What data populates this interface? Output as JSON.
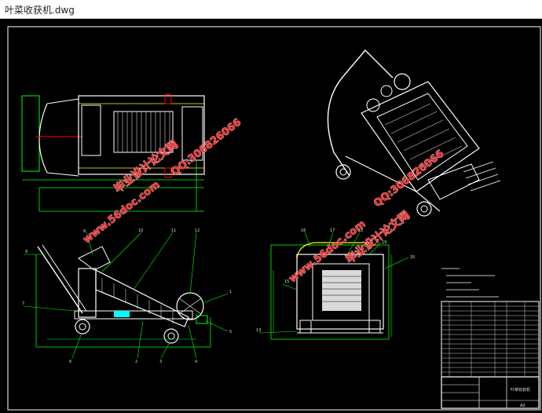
{
  "window": {
    "title": "叶菜收获机.dwg"
  },
  "colors": {
    "canvas": "#000000",
    "frame_white": "#ffffff",
    "cad_green": "#00ff00",
    "cad_yellow": "#ffff00",
    "cad_red": "#ff0000",
    "cad_cyan": "#00ffff",
    "watermark": "#ff2a2a"
  },
  "drawing": {
    "watermarks": [
      "毕业设计论文网",
      "www.56doc.com",
      "QQ:306826066",
      "www.56doc.com",
      "QQ:306826066",
      "毕业设计论文网"
    ],
    "part_numbers": [
      "8",
      "9",
      "10",
      "11",
      "12",
      "6",
      "7",
      "1",
      "2",
      "3",
      "4",
      "5",
      "13",
      "15",
      "16",
      "17",
      "18",
      "19",
      "20"
    ],
    "title_block_name": "叶菜收获机",
    "sheet_size": "A0"
  }
}
